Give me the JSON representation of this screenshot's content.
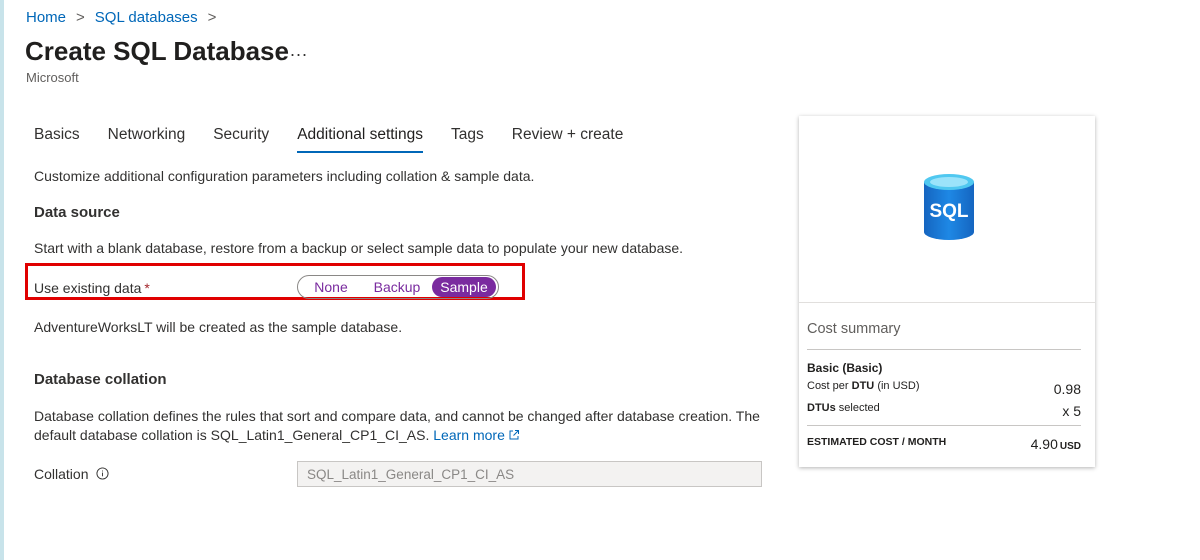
{
  "breadcrumb": {
    "home": "Home",
    "parent": "SQL databases",
    "separator": ">"
  },
  "page": {
    "title": "Create SQL Database",
    "more": "...",
    "publisher": "Microsoft"
  },
  "tabs": [
    {
      "label": "Basics",
      "active": false
    },
    {
      "label": "Networking",
      "active": false
    },
    {
      "label": "Security",
      "active": false
    },
    {
      "label": "Additional settings",
      "active": true
    },
    {
      "label": "Tags",
      "active": false
    },
    {
      "label": "Review + create",
      "active": false
    }
  ],
  "intro": "Customize additional configuration parameters including collation & sample data.",
  "data_source": {
    "heading": "Data source",
    "description": "Start with a blank database, restore from a backup or select sample data to populate your new database.",
    "field_label": "Use existing data",
    "required_mark": "*",
    "options": [
      "None",
      "Backup",
      "Sample"
    ],
    "selected": "Sample",
    "note": "AdventureWorksLT will be created as the sample database."
  },
  "collation": {
    "heading": "Database collation",
    "description_line1": "Database collation defines the rules that sort and compare data, and cannot be changed after database creation. The",
    "description_line2": "default database collation is SQL_Latin1_General_CP1_CI_AS.",
    "learn_more": "Learn more",
    "field_label": "Collation",
    "value": "SQL_Latin1_General_CP1_CI_AS"
  },
  "cost_summary": {
    "icon_text": "SQL",
    "title": "Cost summary",
    "plan": "Basic (Basic)",
    "cost_per_prefix": "Cost per",
    "cost_per_unit": "DTU",
    "cost_per_suffix": "(in USD)",
    "cost_per_value": "0.98",
    "dtus_label": "DTUs",
    "dtus_suffix": "selected",
    "dtus_value": "x 5",
    "estimated_label": "ESTIMATED COST / MONTH",
    "estimated_value": "4.90",
    "currency": "USD"
  },
  "colors": {
    "link": "#0067b8",
    "accent": "#7a2b9f",
    "highlight": "#e00000",
    "required": "#a4262c"
  }
}
